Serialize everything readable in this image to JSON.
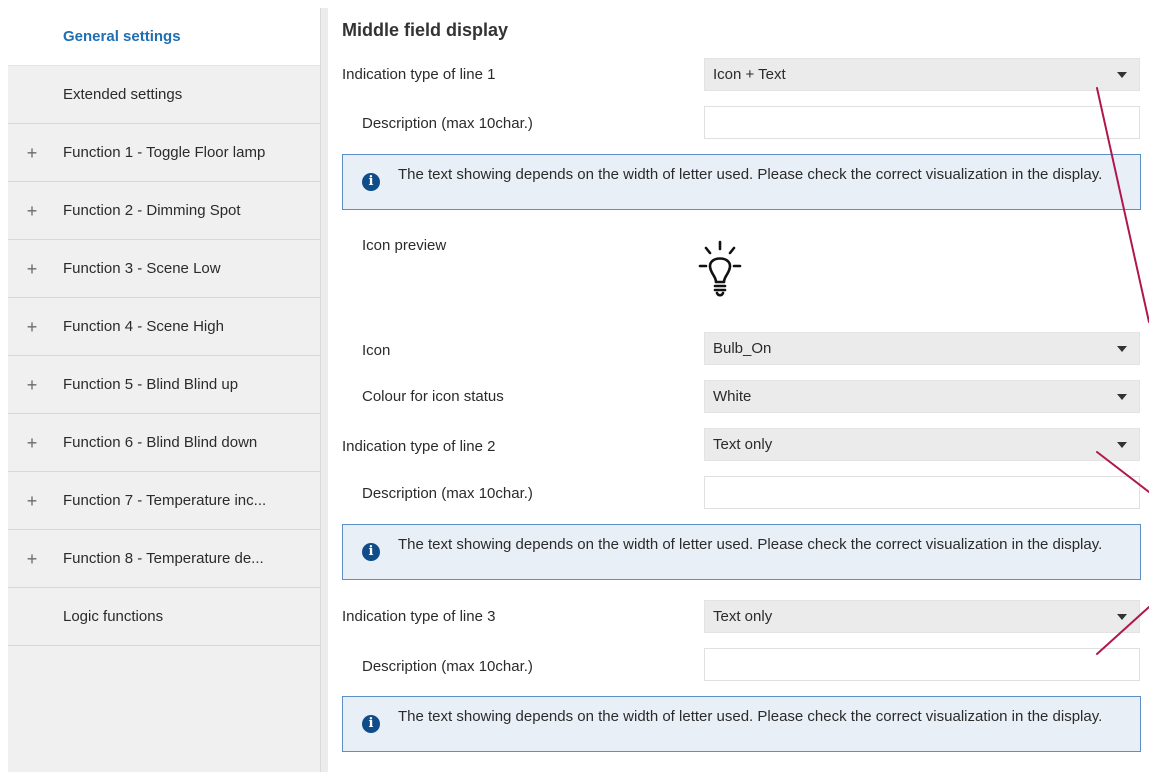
{
  "sidebar": {
    "items": [
      {
        "label": "General settings",
        "expandable": false,
        "active": true
      },
      {
        "label": "Extended settings",
        "expandable": false,
        "active": false
      },
      {
        "label": "Function 1 - Toggle Floor lamp",
        "expandable": true,
        "active": false
      },
      {
        "label": "Function 2 - Dimming Spot",
        "expandable": true,
        "active": false
      },
      {
        "label": "Function 3 - Scene Low",
        "expandable": true,
        "active": false
      },
      {
        "label": "Function 4 - Scene High",
        "expandable": true,
        "active": false
      },
      {
        "label": "Function 5 - Blind Blind up",
        "expandable": true,
        "active": false
      },
      {
        "label": "Function 6 - Blind Blind down",
        "expandable": true,
        "active": false
      },
      {
        "label": "Function 7 - Temperature inc...",
        "expandable": true,
        "active": false
      },
      {
        "label": "Function 8 - Temperature de...",
        "expandable": true,
        "active": false
      },
      {
        "label": "Logic functions",
        "expandable": false,
        "active": false
      }
    ],
    "plus_symbol": "+"
  },
  "main": {
    "title": "Middle field display",
    "line1": {
      "label": "Indication type of line 1",
      "value": "Icon + Text"
    },
    "line1_description": {
      "label": "Description (max 10char.)",
      "value": ""
    },
    "info1": "The text showing depends on the width of letter used. Please check the correct visualization in the display.",
    "icon_preview": {
      "label": "Icon preview",
      "icon": "lightbulb-on-icon"
    },
    "icon": {
      "label": "Icon",
      "value": "Bulb_On"
    },
    "icon_colour": {
      "label": "Colour for icon status",
      "value": "White"
    },
    "line2": {
      "label": "Indication type of line 2",
      "value": "Text only"
    },
    "line2_description": {
      "label": "Description (max 10char.)",
      "value": ""
    },
    "info2": "The text showing depends on the width of letter used. Please check the correct visualization in the display.",
    "line3": {
      "label": "Indication type of line 3",
      "value": "Text only"
    },
    "line3_description": {
      "label": "Description (max 10char.)",
      "value": ""
    },
    "info3": "The text showing depends on the width of letter used. Please check the correct visualization in the display."
  },
  "colors": {
    "accent": "#1f6fb2",
    "info_border": "#5b8fc6",
    "info_background": "#e9eff6",
    "annotation_line": "#b0174f"
  }
}
